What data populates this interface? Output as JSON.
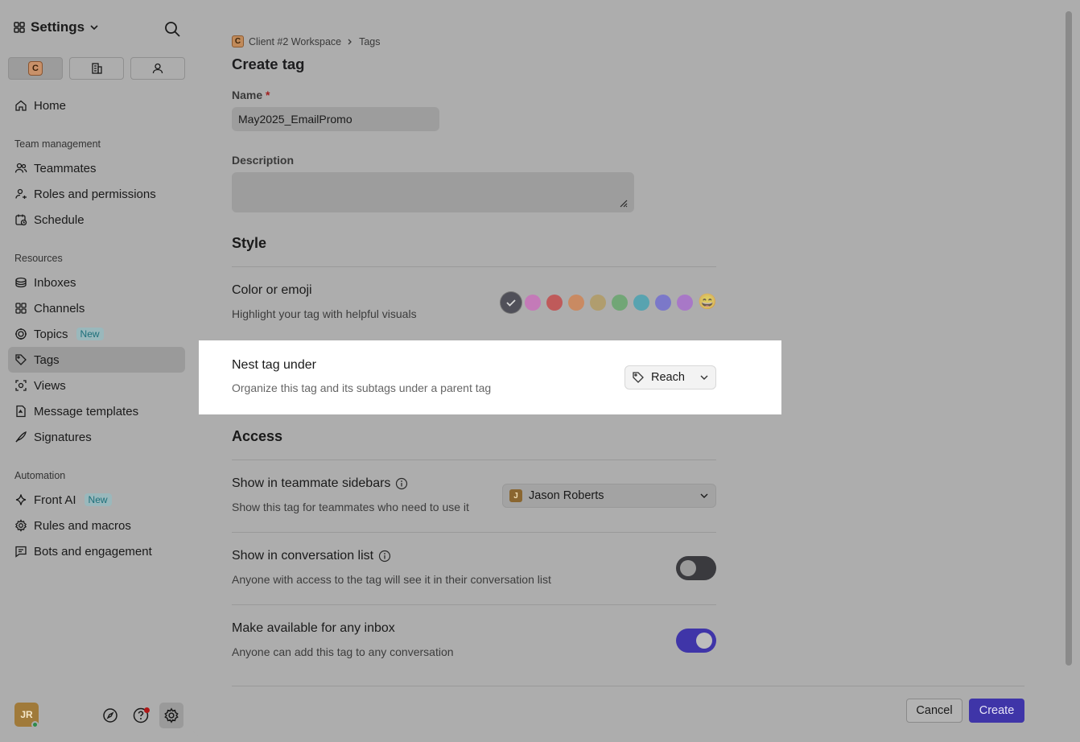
{
  "sidebar": {
    "title": "Settings",
    "workspace_initial": "C",
    "nav": [
      {
        "label": "Home",
        "icon": "home-icon"
      },
      {
        "label": "Teammates",
        "icon": "users-icon"
      },
      {
        "label": "Roles and permissions",
        "icon": "user-key-icon"
      },
      {
        "label": "Schedule",
        "icon": "schedule-icon"
      },
      {
        "label": "Inboxes",
        "icon": "inbox-icon"
      },
      {
        "label": "Channels",
        "icon": "grid-icon"
      },
      {
        "label": "Topics",
        "icon": "topics-icon",
        "badge": "New"
      },
      {
        "label": "Tags",
        "icon": "tag-icon"
      },
      {
        "label": "Views",
        "icon": "views-icon"
      },
      {
        "label": "Message templates",
        "icon": "template-icon"
      },
      {
        "label": "Signatures",
        "icon": "signature-icon"
      },
      {
        "label": "Front AI",
        "icon": "sparkle-icon",
        "badge": "New"
      },
      {
        "label": "Rules and macros",
        "icon": "gear-icon"
      },
      {
        "label": "Bots and engagement",
        "icon": "chat-icon"
      }
    ],
    "sections": [
      "Team management",
      "Resources",
      "Automation"
    ],
    "user_initials": "JR"
  },
  "breadcrumb": {
    "workspace": "Client #2 Workspace",
    "workspace_initial": "C",
    "current": "Tags"
  },
  "page_title": "Create tag",
  "form": {
    "name_label": "Name",
    "required_mark": "*",
    "name_value": "May2025_EmailPromo",
    "description_label": "Description",
    "description_value": ""
  },
  "style": {
    "heading": "Style",
    "color_title": "Color or emoji",
    "color_desc": "Highlight your tag with helpful visuals",
    "colors": [
      "#505059",
      "#c47ab8",
      "#bf5a5a",
      "#c98a62",
      "#b09d6e",
      "#71a676",
      "#58a3b0",
      "#7b78c9",
      "#a878c7"
    ],
    "emoji": "😄",
    "nest_title": "Nest tag under",
    "nest_desc": "Organize this tag and its subtags under a parent tag",
    "nest_value": "Reach"
  },
  "access": {
    "heading": "Access",
    "sidebars_title": "Show in teammate sidebars",
    "sidebars_desc": "Show this tag for teammates who need to use it",
    "teammate_initial": "J",
    "teammate_name": "Jason Roberts",
    "convlist_title": "Show in conversation list",
    "convlist_desc": "Anyone with access to the tag will see it in their conversation list",
    "convlist_on": false,
    "inbox_title": "Make available for any inbox",
    "inbox_desc": "Anyone can add this tag to any conversation",
    "inbox_on": true
  },
  "actions": {
    "cancel": "Cancel",
    "create": "Create"
  },
  "colors": {
    "accent": "#3f35a8",
    "highlight": "#ffffff"
  }
}
